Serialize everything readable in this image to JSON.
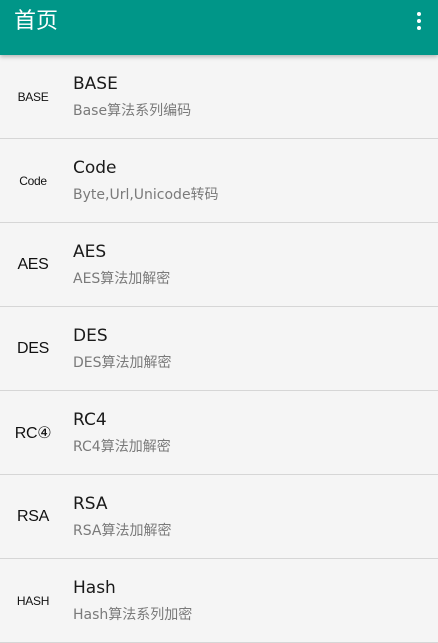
{
  "appbar": {
    "title": "首页",
    "overflow_icon": "more-vert-icon"
  },
  "items": [
    {
      "icon_text": "BASE",
      "title": "BASE",
      "subtitle": "Base算法系列编码"
    },
    {
      "icon_text": "Code",
      "title": "Code",
      "subtitle": "Byte,Url,Unicode转码"
    },
    {
      "icon_text": "AES",
      "title": "AES",
      "subtitle": "AES算法加解密"
    },
    {
      "icon_text": "DES",
      "title": "DES",
      "subtitle": "DES算法加解密"
    },
    {
      "icon_text": "RC④",
      "title": "RC4",
      "subtitle": "RC4算法加解密"
    },
    {
      "icon_text": "RSA",
      "title": "RSA",
      "subtitle": "RSA算法加解密"
    },
    {
      "icon_text": "HASH",
      "title": "Hash",
      "subtitle": "Hash算法系列加密"
    }
  ],
  "colors": {
    "primary": "#009688",
    "background": "#f5f5f5",
    "divider": "#d6d6d6"
  }
}
